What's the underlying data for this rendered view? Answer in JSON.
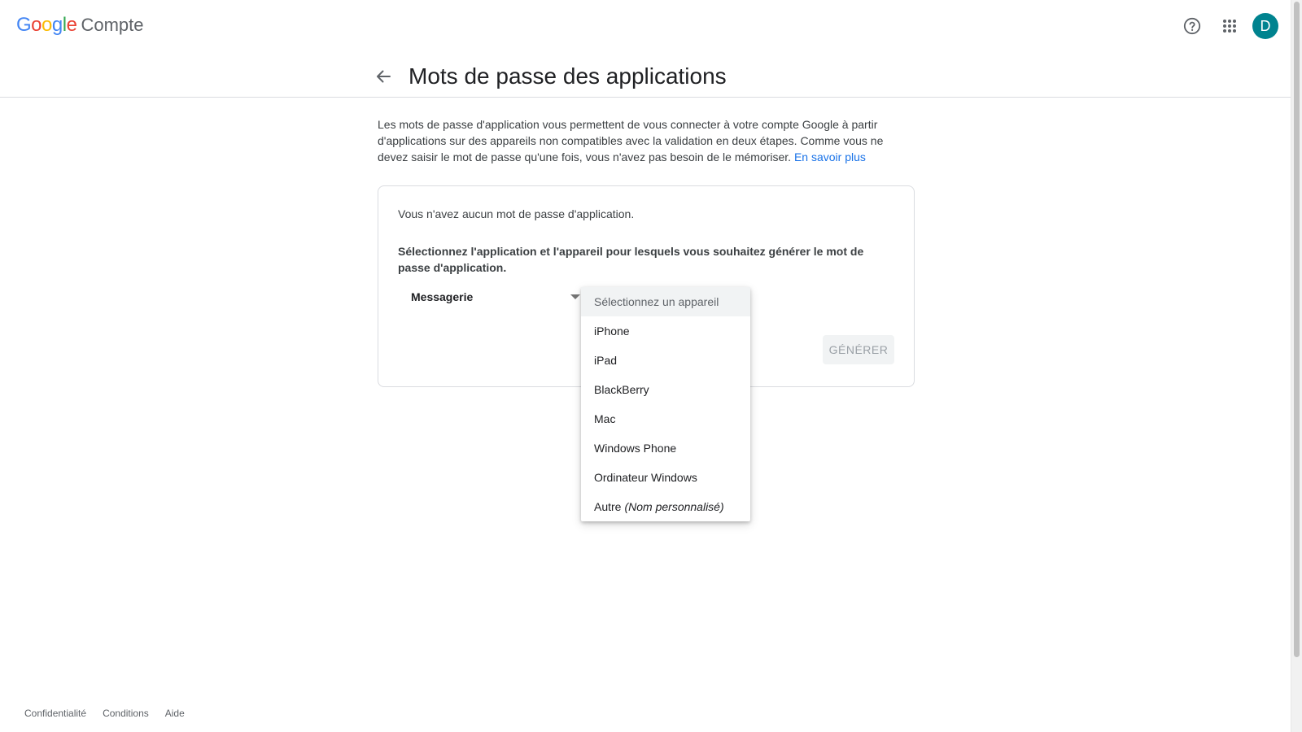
{
  "brand": {
    "google_letters": [
      {
        "char": "G",
        "color": "#4285F4"
      },
      {
        "char": "o",
        "color": "#EA4335"
      },
      {
        "char": "o",
        "color": "#FBBC05"
      },
      {
        "char": "g",
        "color": "#4285F4"
      },
      {
        "char": "l",
        "color": "#34A853"
      },
      {
        "char": "e",
        "color": "#EA4335"
      }
    ],
    "product": "Compte"
  },
  "header": {
    "help_icon": "help-circle-icon",
    "apps_icon": "apps-grid-icon",
    "avatar_letter": "D",
    "avatar_color": "#00838f"
  },
  "page": {
    "title": "Mots de passe des applications",
    "back_icon": "arrow-back-icon",
    "description": "Les mots de passe d'application vous permettent de vous connecter à votre compte Google à partir d'applications sur des appareils non compatibles avec la validation en deux étapes. Comme vous ne devez saisir le mot de passe qu'une fois, vous n'avez pas besoin de le mémoriser.",
    "learn_more": "En savoir plus"
  },
  "card": {
    "empty_text": "Vous n'avez aucun mot de passe d'application.",
    "instruction": "Sélectionnez l'application et l'appareil pour lesquels vous souhaitez générer le mot de passe d'application.",
    "app_select_value": "Messagerie",
    "generate_label": "GÉNÉRER"
  },
  "device_dropdown": {
    "placeholder": "Sélectionnez un appareil",
    "options": [
      "iPhone",
      "iPad",
      "BlackBerry",
      "Mac",
      "Windows Phone",
      "Ordinateur Windows"
    ],
    "other_label": "Autre",
    "other_hint": "(Nom personnalisé)"
  },
  "footer": {
    "privacy": "Confidentialité",
    "terms": "Conditions",
    "help": "Aide"
  },
  "colors": {
    "link": "#1a73e8",
    "border": "#dadce0",
    "disabled_button_bg": "#f1f3f4",
    "disabled_button_text": "#9aa0a6"
  }
}
